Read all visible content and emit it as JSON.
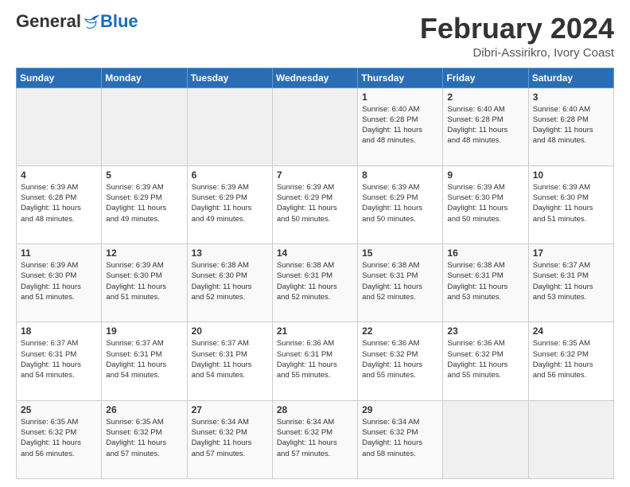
{
  "logo": {
    "general": "General",
    "blue": "Blue"
  },
  "header": {
    "month": "February 2024",
    "location": "Dibri-Assirikro, Ivory Coast"
  },
  "weekdays": [
    "Sunday",
    "Monday",
    "Tuesday",
    "Wednesday",
    "Thursday",
    "Friday",
    "Saturday"
  ],
  "weeks": [
    [
      {
        "day": "",
        "info": ""
      },
      {
        "day": "",
        "info": ""
      },
      {
        "day": "",
        "info": ""
      },
      {
        "day": "",
        "info": ""
      },
      {
        "day": "1",
        "info": "Sunrise: 6:40 AM\nSunset: 6:28 PM\nDaylight: 11 hours\nand 48 minutes."
      },
      {
        "day": "2",
        "info": "Sunrise: 6:40 AM\nSunset: 6:28 PM\nDaylight: 11 hours\nand 48 minutes."
      },
      {
        "day": "3",
        "info": "Sunrise: 6:40 AM\nSunset: 6:28 PM\nDaylight: 11 hours\nand 48 minutes."
      }
    ],
    [
      {
        "day": "4",
        "info": "Sunrise: 6:39 AM\nSunset: 6:28 PM\nDaylight: 11 hours\nand 48 minutes."
      },
      {
        "day": "5",
        "info": "Sunrise: 6:39 AM\nSunset: 6:29 PM\nDaylight: 11 hours\nand 49 minutes."
      },
      {
        "day": "6",
        "info": "Sunrise: 6:39 AM\nSunset: 6:29 PM\nDaylight: 11 hours\nand 49 minutes."
      },
      {
        "day": "7",
        "info": "Sunrise: 6:39 AM\nSunset: 6:29 PM\nDaylight: 11 hours\nand 50 minutes."
      },
      {
        "day": "8",
        "info": "Sunrise: 6:39 AM\nSunset: 6:29 PM\nDaylight: 11 hours\nand 50 minutes."
      },
      {
        "day": "9",
        "info": "Sunrise: 6:39 AM\nSunset: 6:30 PM\nDaylight: 11 hours\nand 50 minutes."
      },
      {
        "day": "10",
        "info": "Sunrise: 6:39 AM\nSunset: 6:30 PM\nDaylight: 11 hours\nand 51 minutes."
      }
    ],
    [
      {
        "day": "11",
        "info": "Sunrise: 6:39 AM\nSunset: 6:30 PM\nDaylight: 11 hours\nand 51 minutes."
      },
      {
        "day": "12",
        "info": "Sunrise: 6:39 AM\nSunset: 6:30 PM\nDaylight: 11 hours\nand 51 minutes."
      },
      {
        "day": "13",
        "info": "Sunrise: 6:38 AM\nSunset: 6:30 PM\nDaylight: 11 hours\nand 52 minutes."
      },
      {
        "day": "14",
        "info": "Sunrise: 6:38 AM\nSunset: 6:31 PM\nDaylight: 11 hours\nand 52 minutes."
      },
      {
        "day": "15",
        "info": "Sunrise: 6:38 AM\nSunset: 6:31 PM\nDaylight: 11 hours\nand 52 minutes."
      },
      {
        "day": "16",
        "info": "Sunrise: 6:38 AM\nSunset: 6:31 PM\nDaylight: 11 hours\nand 53 minutes."
      },
      {
        "day": "17",
        "info": "Sunrise: 6:37 AM\nSunset: 6:31 PM\nDaylight: 11 hours\nand 53 minutes."
      }
    ],
    [
      {
        "day": "18",
        "info": "Sunrise: 6:37 AM\nSunset: 6:31 PM\nDaylight: 11 hours\nand 54 minutes."
      },
      {
        "day": "19",
        "info": "Sunrise: 6:37 AM\nSunset: 6:31 PM\nDaylight: 11 hours\nand 54 minutes."
      },
      {
        "day": "20",
        "info": "Sunrise: 6:37 AM\nSunset: 6:31 PM\nDaylight: 11 hours\nand 54 minutes."
      },
      {
        "day": "21",
        "info": "Sunrise: 6:36 AM\nSunset: 6:31 PM\nDaylight: 11 hours\nand 55 minutes."
      },
      {
        "day": "22",
        "info": "Sunrise: 6:36 AM\nSunset: 6:32 PM\nDaylight: 11 hours\nand 55 minutes."
      },
      {
        "day": "23",
        "info": "Sunrise: 6:36 AM\nSunset: 6:32 PM\nDaylight: 11 hours\nand 55 minutes."
      },
      {
        "day": "24",
        "info": "Sunrise: 6:35 AM\nSunset: 6:32 PM\nDaylight: 11 hours\nand 56 minutes."
      }
    ],
    [
      {
        "day": "25",
        "info": "Sunrise: 6:35 AM\nSunset: 6:32 PM\nDaylight: 11 hours\nand 56 minutes."
      },
      {
        "day": "26",
        "info": "Sunrise: 6:35 AM\nSunset: 6:32 PM\nDaylight: 11 hours\nand 57 minutes."
      },
      {
        "day": "27",
        "info": "Sunrise: 6:34 AM\nSunset: 6:32 PM\nDaylight: 11 hours\nand 57 minutes."
      },
      {
        "day": "28",
        "info": "Sunrise: 6:34 AM\nSunset: 6:32 PM\nDaylight: 11 hours\nand 57 minutes."
      },
      {
        "day": "29",
        "info": "Sunrise: 6:34 AM\nSunset: 6:32 PM\nDaylight: 11 hours\nand 58 minutes."
      },
      {
        "day": "",
        "info": ""
      },
      {
        "day": "",
        "info": ""
      }
    ]
  ]
}
